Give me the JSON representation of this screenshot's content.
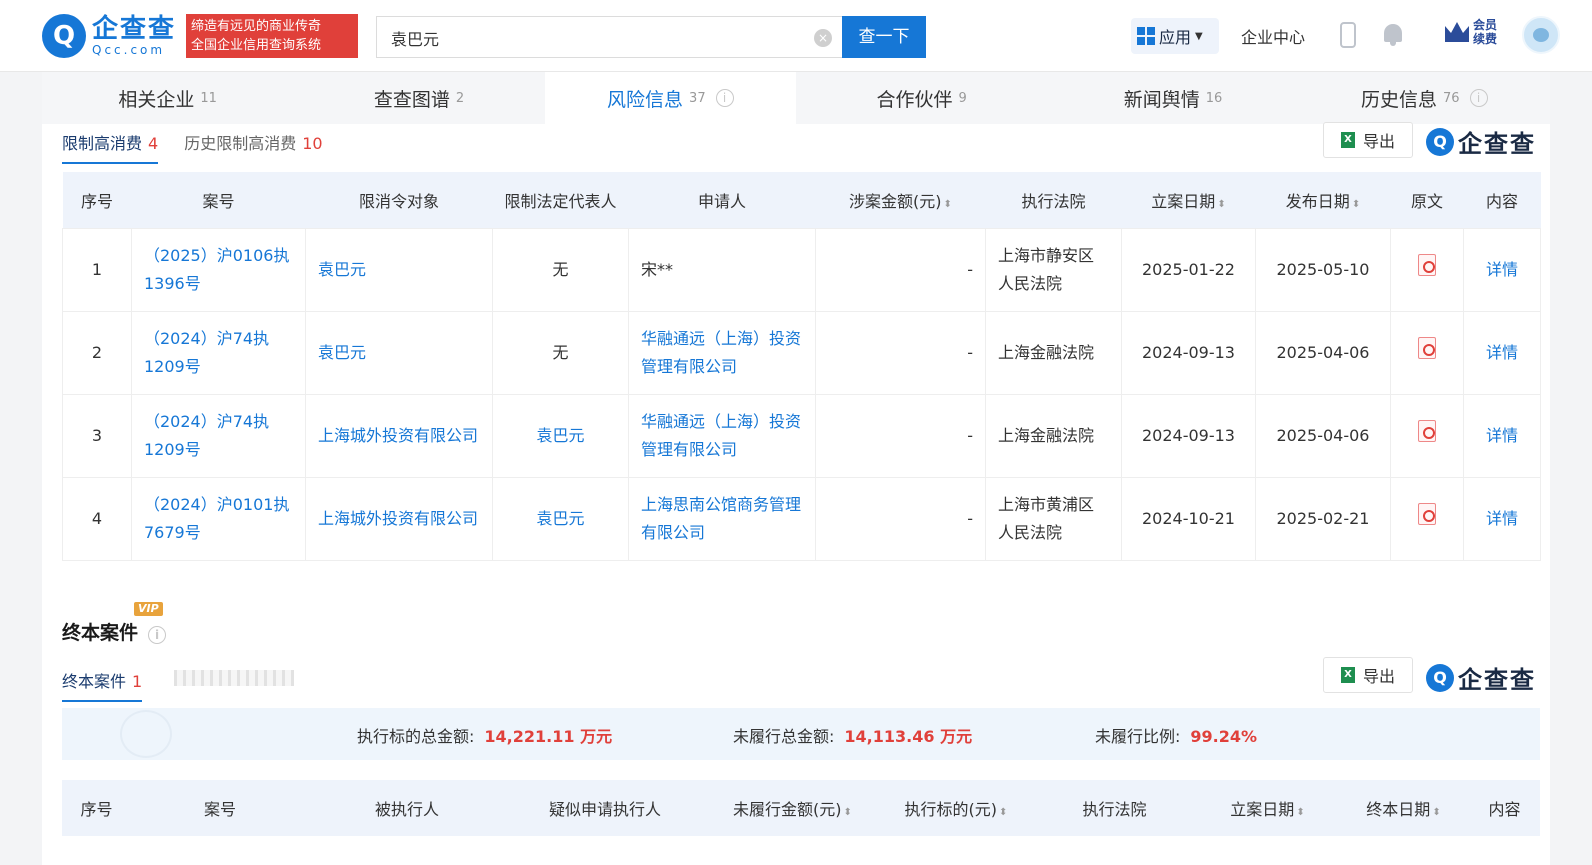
{
  "header": {
    "logo_mark": "Q",
    "logo_name": "企查查",
    "logo_domain": "Qcc.com",
    "slogan_line1": "缔造有远见的商业传奇",
    "slogan_line2": "全国企业信用查询系统",
    "search_value": "袁巴元",
    "clear_glyph": "×",
    "search_button": "查一下",
    "apps_label": "应用",
    "enterprise_center": "企业中心",
    "vip_line1": "会员",
    "vip_line2": "续费"
  },
  "tabs": [
    {
      "label": "相关企业",
      "count": "11"
    },
    {
      "label": "查查图谱",
      "count": "2"
    },
    {
      "label": "风险信息",
      "count": "37"
    },
    {
      "label": "合作伙伴",
      "count": "9"
    },
    {
      "label": "新闻舆情",
      "count": "16"
    },
    {
      "label": "历史信息",
      "count": "76"
    }
  ],
  "info_glyph": "i",
  "restriction": {
    "subtabs": [
      {
        "label": "限制高消费",
        "count": "4"
      },
      {
        "label": "历史限制高消费",
        "count": "10"
      }
    ],
    "export_label": "导出",
    "excel_glyph": "X",
    "brand_mark": "Q",
    "brand_name": "企查查",
    "columns": [
      "序号",
      "案号",
      "限消令对象",
      "限制法定代表人",
      "申请人",
      "涉案金额(元)",
      "执行法院",
      "立案日期",
      "发布日期",
      "原文",
      "内容"
    ],
    "sort_glyph": "⬍",
    "rows": [
      {
        "no": "1",
        "case": "（2025）沪0106执1396号",
        "target": "袁巴元",
        "rep": "无",
        "applicant": "宋**",
        "amount": "-",
        "court": "上海市静安区人民法院",
        "filed": "2025-01-22",
        "published": "2025-05-10",
        "detail": "详情"
      },
      {
        "no": "2",
        "case": "（2024）沪74执1209号",
        "target": "袁巴元",
        "rep": "无",
        "applicant": "华融通远（上海）投资管理有限公司",
        "amount": "-",
        "court": "上海金融法院",
        "filed": "2024-09-13",
        "published": "2025-04-06",
        "detail": "详情"
      },
      {
        "no": "3",
        "case": "（2024）沪74执1209号",
        "target": "上海城外投资有限公司",
        "rep": "袁巴元",
        "applicant": "华融通远（上海）投资管理有限公司",
        "amount": "-",
        "court": "上海金融法院",
        "filed": "2024-09-13",
        "published": "2025-04-06",
        "detail": "详情"
      },
      {
        "no": "4",
        "case": "（2024）沪0101执7679号",
        "target": "上海城外投资有限公司",
        "rep": "袁巴元",
        "applicant": "上海思南公馆商务管理有限公司",
        "amount": "-",
        "court": "上海市黄浦区人民法院",
        "filed": "2024-10-21",
        "published": "2025-02-21",
        "detail": "详情"
      }
    ]
  },
  "terminated": {
    "vip_tag": "VIP",
    "title": "终本案件",
    "subtab_label": "终本案件",
    "subtab_count": "1",
    "export_label": "导出",
    "summary": {
      "total_label": "执行标的总金额:",
      "total_value": "14,221.11 万元",
      "unfulfilled_label": "未履行总金额:",
      "unfulfilled_value": "14,113.46 万元",
      "ratio_label": "未履行比例:",
      "ratio_value": "99.24%"
    },
    "columns": [
      "序号",
      "案号",
      "被执行人",
      "疑似申请执行人",
      "未履行金额(元)",
      "执行标的(元)",
      "执行法院",
      "立案日期",
      "终本日期",
      "内容"
    ]
  },
  "colors": {
    "accent": "#1677d6",
    "danger": "#e0403a",
    "header_bg": "#eef3fb"
  }
}
